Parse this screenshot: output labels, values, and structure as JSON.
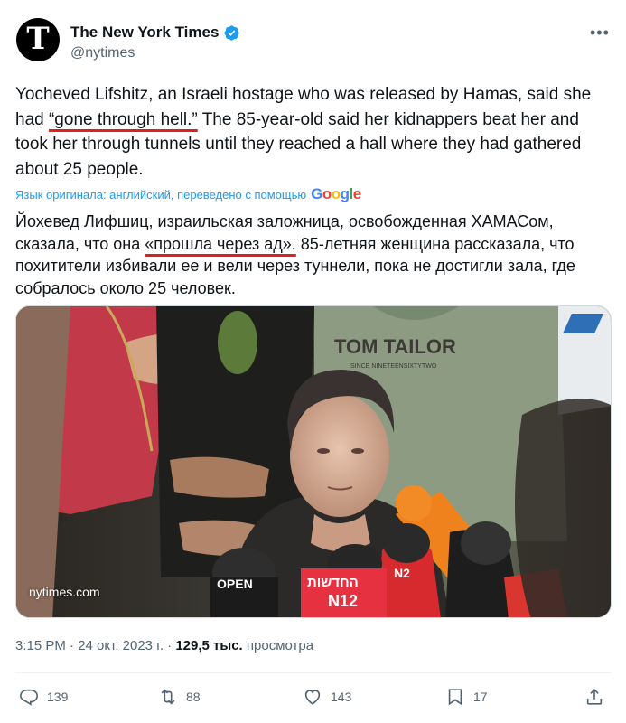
{
  "account": {
    "name": "The New York Times",
    "handle": "@nytimes",
    "avatar_letter": "T",
    "verified": true,
    "verified_color": "#1d9bf0"
  },
  "tweet": {
    "text_part1": "Yocheved Lifshitz, an Israeli hostage who was released by Hamas, said she had ",
    "text_quote": "“gone through hell.”",
    "text_part2": " The 85-year-old said her kidnappers beat her and took her through tunnels until they reached a hall where they had gathered about 25 people.",
    "translate_note": "Язык оригинала: английский, переведено с помощью",
    "translate_provider": "Google",
    "translated_part1": "Йохевед Лифшиц, израильская заложница, освобожденная ХАМАСом, сказала, что она ",
    "translated_quote": "«прошла через ад».",
    "translated_part2": " 85-летняя женщина рассказала, что похитители избивали ее и вели через туннели, пока не достигли зала, где собралось около 25 человек."
  },
  "image": {
    "source_label": "nytimes.com",
    "shirt_text_1": "TOM TAILOR",
    "shirt_text_2": "SINCE NINETEENSIXTYTWO",
    "mic_label_1": "החדשות",
    "mic_label_2": "N12",
    "mic_label_3": "OPEN"
  },
  "meta": {
    "time_date": "3:15 PM · 24 окт. 2023 г. · ",
    "views_count": "129,5 тыс.",
    "views_label": " просмотра"
  },
  "actions": {
    "replies": "139",
    "reposts": "88",
    "likes": "143",
    "bookmarks": "17"
  },
  "colors": {
    "accent": "#1d9bf0",
    "underline": "#e0201e",
    "secondary_text": "#536471"
  }
}
